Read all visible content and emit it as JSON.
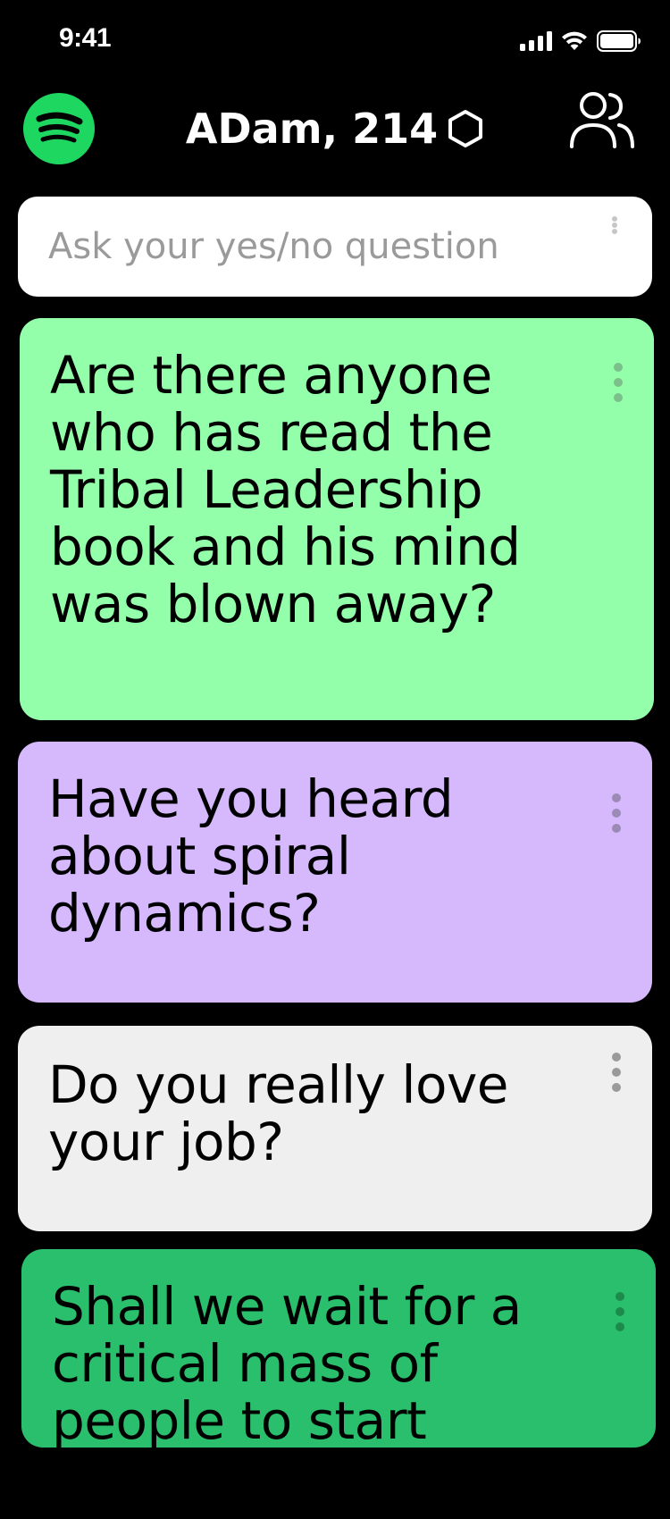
{
  "status_bar": {
    "time": "9:41"
  },
  "header": {
    "title": "ADam, 214",
    "logo_icon": "spotify-logo-icon",
    "hex_icon": "hexagon-icon",
    "users_icon": "users-icon"
  },
  "search": {
    "placeholder": "Ask your yes/no question",
    "value": ""
  },
  "cards": [
    {
      "text": "Are there anyone who has read the Tribal Leadership book and his mind was blown away?",
      "color": "#94ffab"
    },
    {
      "text": "Have you heard about spiral dynamics?",
      "color": "#d6b8fd"
    },
    {
      "text": "Do you really love your job?",
      "color": "#efefef"
    },
    {
      "text": "Shall we wait for a critical mass of people to start",
      "color": "#2abf6c"
    }
  ],
  "colors": {
    "background": "#000000",
    "brand_green": "#1ed760",
    "menu_dots": "#8a8a8a"
  }
}
